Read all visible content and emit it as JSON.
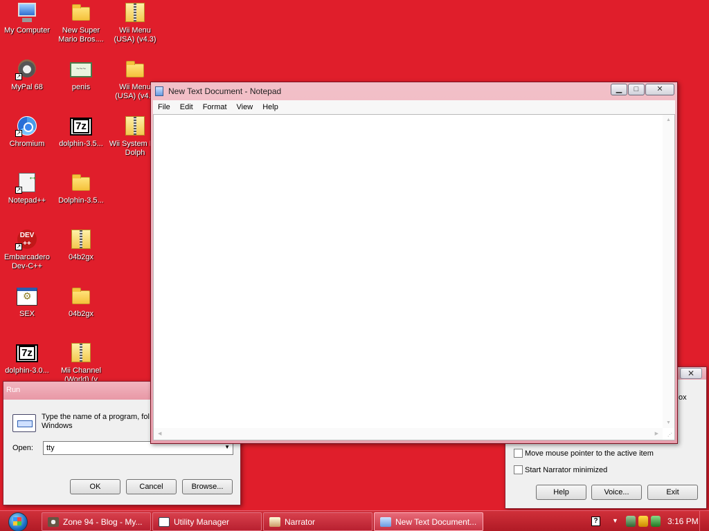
{
  "desktop": {
    "icons": [
      {
        "label": "My Computer",
        "icon": "computer-icon"
      },
      {
        "label": "New Super Mario Bros....",
        "icon": "folder-icon"
      },
      {
        "label": "Wii Menu (USA) (v4.3)",
        "icon": "zip-folder-icon"
      },
      {
        "label": "MyPal 68",
        "icon": "mypal-icon"
      },
      {
        "label": "penis",
        "icon": "certificate-icon"
      },
      {
        "label": "Wii Menu (USA) (v4.3",
        "icon": "folder-icon"
      },
      {
        "label": "Chromium",
        "icon": "chromium-icon"
      },
      {
        "label": "dolphin-3.5...",
        "icon": "7z-icon"
      },
      {
        "label": "Wii System For Dolph",
        "icon": "zip-folder-icon"
      },
      {
        "label": "Notepad++",
        "icon": "notepadpp-icon"
      },
      {
        "label": "Dolphin-3.5...",
        "icon": "folder-icon"
      },
      {
        "label": "Embarcadero Dev-C++",
        "icon": "devcpp-icon"
      },
      {
        "label": "04b2gx",
        "icon": "zip-folder-icon"
      },
      {
        "label": "SEX",
        "icon": "exe-icon"
      },
      {
        "label": "04b2gx",
        "icon": "folder-icon"
      },
      {
        "label": "dolphin-3.0...",
        "icon": "7z-icon"
      },
      {
        "label": "Mii Channel (World) (v",
        "icon": "zip-folder-icon"
      }
    ],
    "icon_glyphs": {
      "dev": "DEV\n++",
      "sevenz": "7z",
      "cert": "~~~",
      "shortcut": "↗"
    }
  },
  "notepad": {
    "title": "New Text Document - Notepad",
    "menu": [
      "File",
      "Edit",
      "Format",
      "View",
      "Help"
    ],
    "content": "",
    "buttons": {
      "minimize": "▁",
      "maximize": "□",
      "close": "✕"
    }
  },
  "run_dialog": {
    "title": "Run",
    "description": "Type the name of a program, fol Internet resource, and Windows",
    "open_label": "Open:",
    "open_value": "tty",
    "ok_label": "OK",
    "cancel_label": "Cancel",
    "browse_label": "Browse..."
  },
  "narrator_dialog": {
    "close": "✕",
    "fragment": "ox",
    "options": [
      {
        "label": "Move mouse pointer to the active item",
        "checked": false
      },
      {
        "label": "Start Narrator minimized",
        "checked": false
      }
    ],
    "help_label": "Help",
    "voice_label": "Voice...",
    "exit_label": "Exit"
  },
  "taskbar": {
    "tasks": [
      {
        "label": "Zone 94 - Blog - My...",
        "active": false
      },
      {
        "label": "Utility Manager",
        "active": false
      },
      {
        "label": "Narrator",
        "active": false
      },
      {
        "label": "New Text Document...",
        "active": true
      }
    ],
    "tray": {
      "help_glyph": "?",
      "up_arrow": "▼",
      "clock": "3:16 PM"
    }
  },
  "colors": {
    "desktop_bg": "#e01e2b",
    "taskbar": "#b01a25",
    "window_frame": "#e8a0ae"
  }
}
